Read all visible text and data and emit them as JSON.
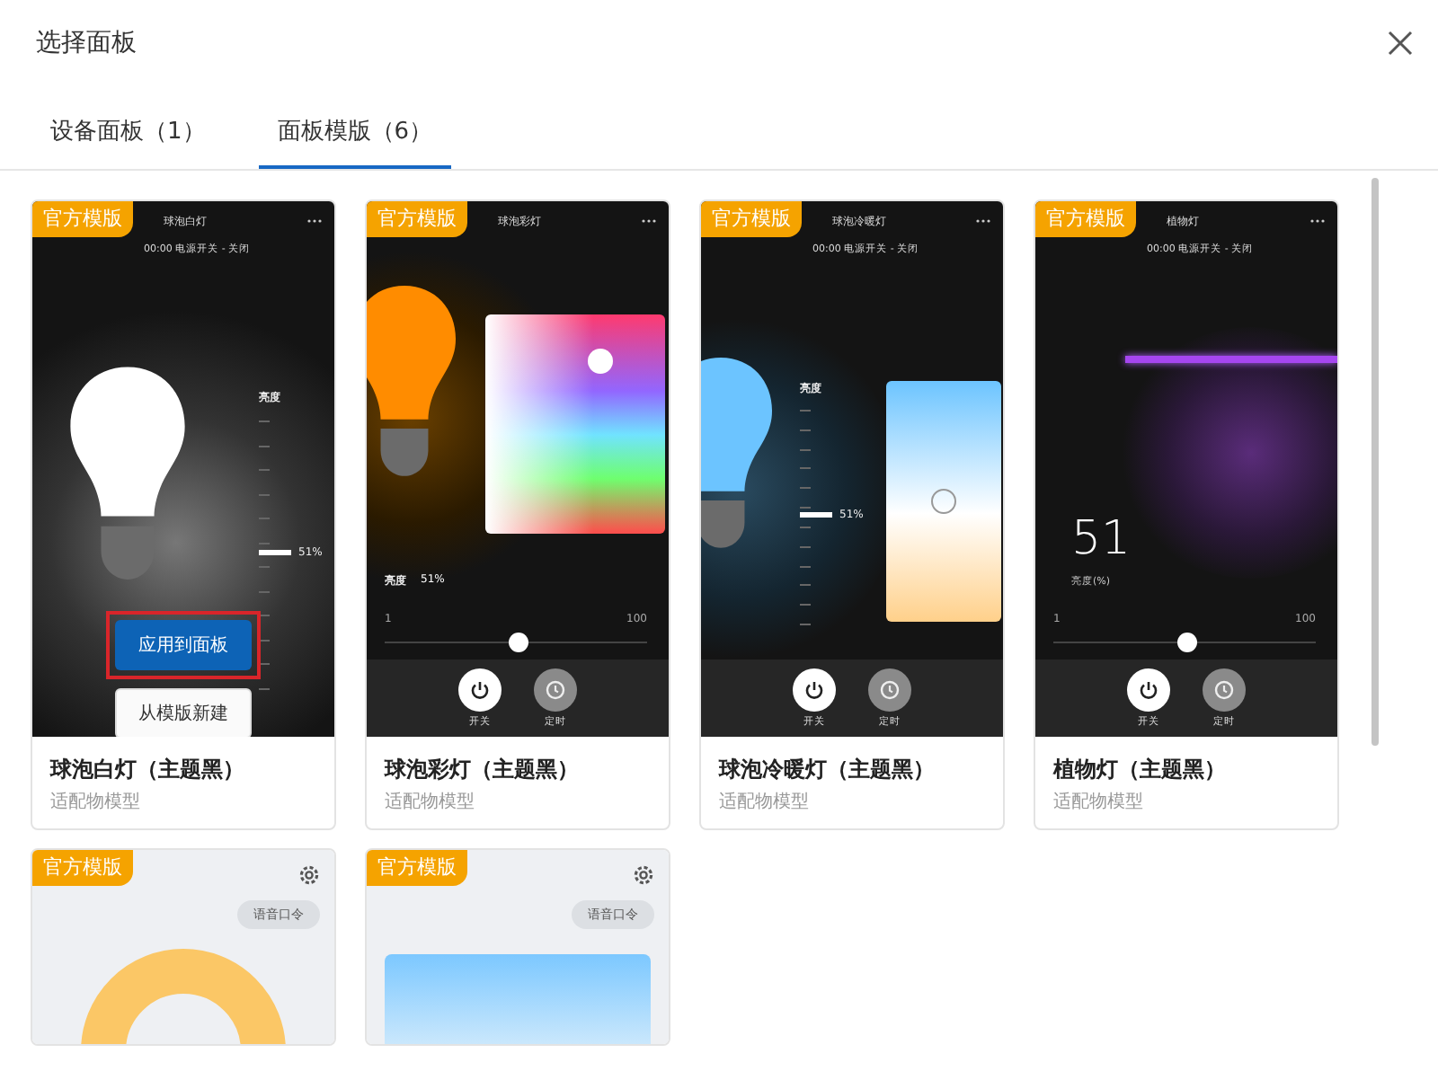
{
  "dialog": {
    "title": "选择面板"
  },
  "tabs": [
    {
      "label": "设备面板（1）",
      "selected": false
    },
    {
      "label": "面板模版（6）",
      "selected": true
    }
  ],
  "templates": [
    {
      "kind": "white",
      "badge": "官方模版",
      "device_name": "球泡白灯",
      "schedule": "00:00 电源开关 - 关闭",
      "brightness_label": "亮度",
      "reading": "51%",
      "level": 0.51,
      "actions": [
        {
          "label": "应用到面板",
          "kind": "primary",
          "highlighted": true
        },
        {
          "label": "从模版新建",
          "kind": "secondary",
          "highlighted": false
        }
      ],
      "name": "球泡白灯（主题黑）",
      "subtitle": "适配物模型"
    },
    {
      "kind": "color",
      "badge": "官方模版",
      "device_name": "球泡彩灯",
      "brightness_label": "亮度",
      "reading": "51%",
      "min": "1",
      "max": "100",
      "level": 0.51,
      "controls": [
        {
          "label": "开关",
          "kind": "power"
        },
        {
          "label": "定时",
          "kind": "timer"
        }
      ],
      "name": "球泡彩灯（主题黑）",
      "subtitle": "适配物模型"
    },
    {
      "kind": "warm",
      "badge": "官方模版",
      "device_name": "球泡冷暖灯",
      "schedule": "00:00 电源开关 - 关闭",
      "brightness_label": "亮度",
      "reading": "51%",
      "level": 0.51,
      "controls": [
        {
          "label": "开关",
          "kind": "power"
        },
        {
          "label": "定时",
          "kind": "timer"
        }
      ],
      "name": "球泡冷暖灯（主题黑）",
      "subtitle": "适配物模型"
    },
    {
      "kind": "plant",
      "badge": "官方模版",
      "device_name": "植物灯",
      "schedule": "00:00 电源开关 - 关闭",
      "value": "51",
      "value_label": "亮度(%)",
      "min": "1",
      "max": "100",
      "level": 0.51,
      "controls": [
        {
          "label": "开关",
          "kind": "power"
        },
        {
          "label": "定时",
          "kind": "timer"
        }
      ],
      "name": "植物灯（主题黑）",
      "subtitle": "适配物模型"
    },
    {
      "kind": "ring",
      "badge": "官方模版",
      "voice_command": "语音口令"
    },
    {
      "kind": "panel",
      "badge": "官方模版",
      "voice_command": "语音口令"
    }
  ]
}
